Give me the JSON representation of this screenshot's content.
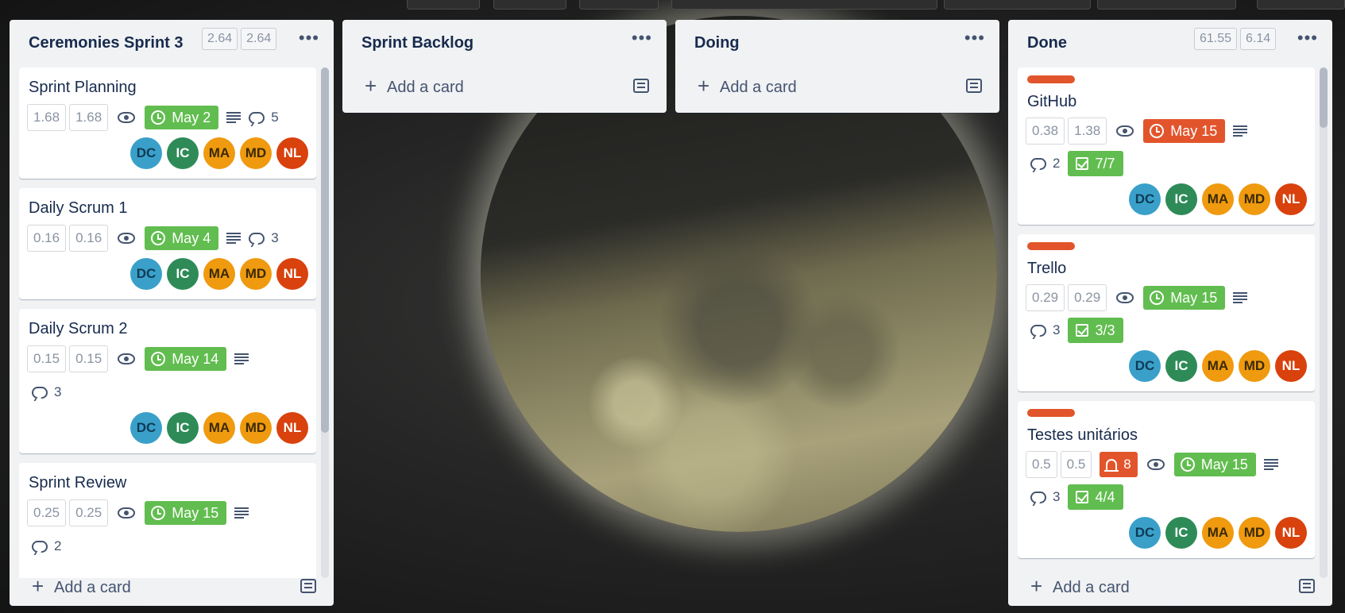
{
  "members": [
    {
      "initials": "DC",
      "color": "#3aa0c9"
    },
    {
      "initials": "IC",
      "color": "#2e8b57"
    },
    {
      "initials": "MA",
      "color": "#ef9a0f"
    },
    {
      "initials": "MD",
      "color": "#ef9a0f"
    },
    {
      "initials": "NL",
      "color": "#d9410d"
    }
  ],
  "colors": {
    "green_due": "#61bd4f",
    "red_due": "#e2552c",
    "label_orange": "#e2552c",
    "list_bg": "#f1f2f4"
  },
  "lists": [
    {
      "title": "Ceremonies Sprint 3",
      "points": [
        "2.64",
        "2.64"
      ],
      "add_card": "Add a card",
      "cards": [
        {
          "title": "Sprint Planning",
          "points": [
            "1.68",
            "1.68"
          ],
          "due": "May 2",
          "due_status": "green",
          "comments": "5"
        },
        {
          "title": "Daily Scrum 1",
          "points": [
            "0.16",
            "0.16"
          ],
          "due": "May 4",
          "due_status": "green",
          "comments": "3"
        },
        {
          "title": "Daily Scrum 2",
          "points": [
            "0.15",
            "0.15"
          ],
          "due": "May 14",
          "due_status": "green",
          "comments": "3"
        },
        {
          "title": "Sprint Review",
          "points": [
            "0.25",
            "0.25"
          ],
          "due": "May 15",
          "due_status": "green",
          "comments": "2"
        }
      ]
    },
    {
      "title": "Sprint Backlog",
      "add_card": "Add a card",
      "cards": []
    },
    {
      "title": "Doing",
      "add_card": "Add a card",
      "cards": []
    },
    {
      "title": "Done",
      "points": [
        "61.55",
        "6.14"
      ],
      "add_card": "Add a card",
      "cards": [
        {
          "title": "GitHub",
          "points": [
            "0.38",
            "1.38"
          ],
          "due": "May 15",
          "due_status": "red",
          "comments": "2",
          "checklist": "7/7"
        },
        {
          "title": "Trello",
          "points": [
            "0.29",
            "0.29"
          ],
          "due": "May 15",
          "due_status": "green",
          "comments": "3",
          "checklist": "3/3"
        },
        {
          "title": "Testes unitários",
          "points": [
            "0.5",
            "0.5"
          ],
          "alert": "8",
          "due": "May 15",
          "due_status": "green",
          "comments": "3",
          "checklist": "4/4"
        }
      ]
    }
  ]
}
